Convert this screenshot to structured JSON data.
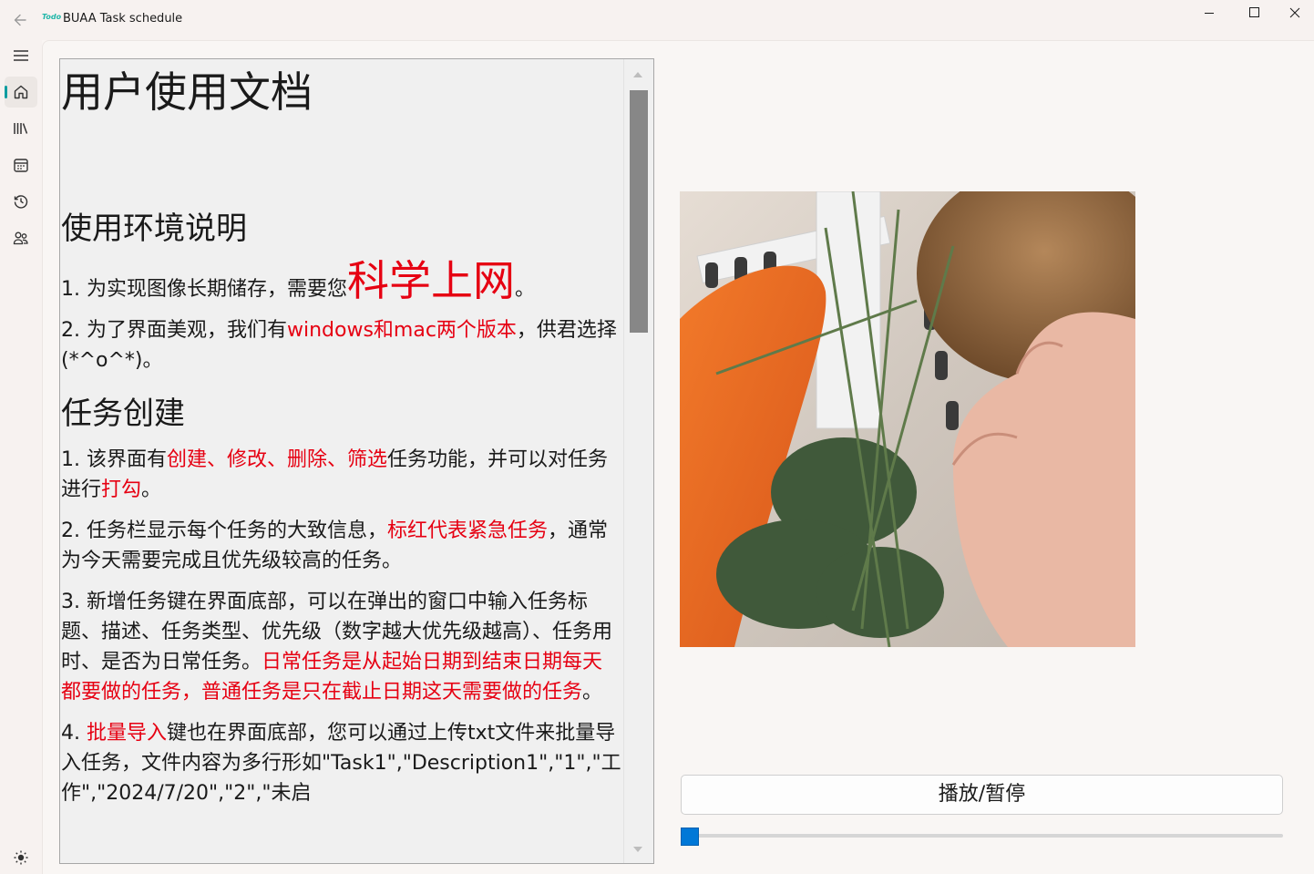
{
  "window": {
    "logo_text": "Todo",
    "title": "BUAA Task schedule"
  },
  "nav": {
    "items": [
      {
        "name": "menu-icon"
      },
      {
        "name": "home-icon",
        "active": true
      },
      {
        "name": "library-icon"
      },
      {
        "name": "calendar-icon"
      },
      {
        "name": "history-icon"
      },
      {
        "name": "people-icon"
      }
    ],
    "bottom": {
      "name": "theme-toggle-icon"
    }
  },
  "doc": {
    "title": "用户使用文档",
    "sec1": {
      "heading": "使用环境说明",
      "p1": {
        "a": "1. 为实现图像长期储存，需要您",
        "red": "科学上网",
        "b": "。"
      },
      "p2": {
        "a": "2. 为了界面美观，我们有",
        "red": "windows和mac两个版本",
        "b": "，供君选择(*^o^*)。"
      }
    },
    "sec2": {
      "heading": "任务创建",
      "p1": {
        "a": "1. 该界面有",
        "red1": "创建、修改、删除、筛选",
        "b": "任务功能，并可以对任务进行",
        "red2": "打勾",
        "c": "。"
      },
      "p2": {
        "a": "2. 任务栏显示每个任务的大致信息，",
        "red": "标红代表紧急任务",
        "b": "，通常为今天需要完成且优先级较高的任务。"
      },
      "p3": {
        "a": "3. 新增任务键在界面底部，可以在弹出的窗口中输入任务标题、描述、任务类型、优先级（数字越大优先级越高）、任务用时、是否为日常任务。",
        "red": "日常任务是从起始日期到结束日期每天都要做的任务，普通任务是只在截止日期这天需要做的任务",
        "b": "。"
      },
      "p4": {
        "a": "4. ",
        "red": "批量导入",
        "b": "键也在界面底部，您可以通过上传txt文件来批量导入任务，文件内容为多行形如\"Task1\",\"Description1\",\"1\",\"工作\",\"2024/7/20\",\"2\",\"未启"
      }
    }
  },
  "player": {
    "play_label": "播放/暂停",
    "progress": 0
  }
}
